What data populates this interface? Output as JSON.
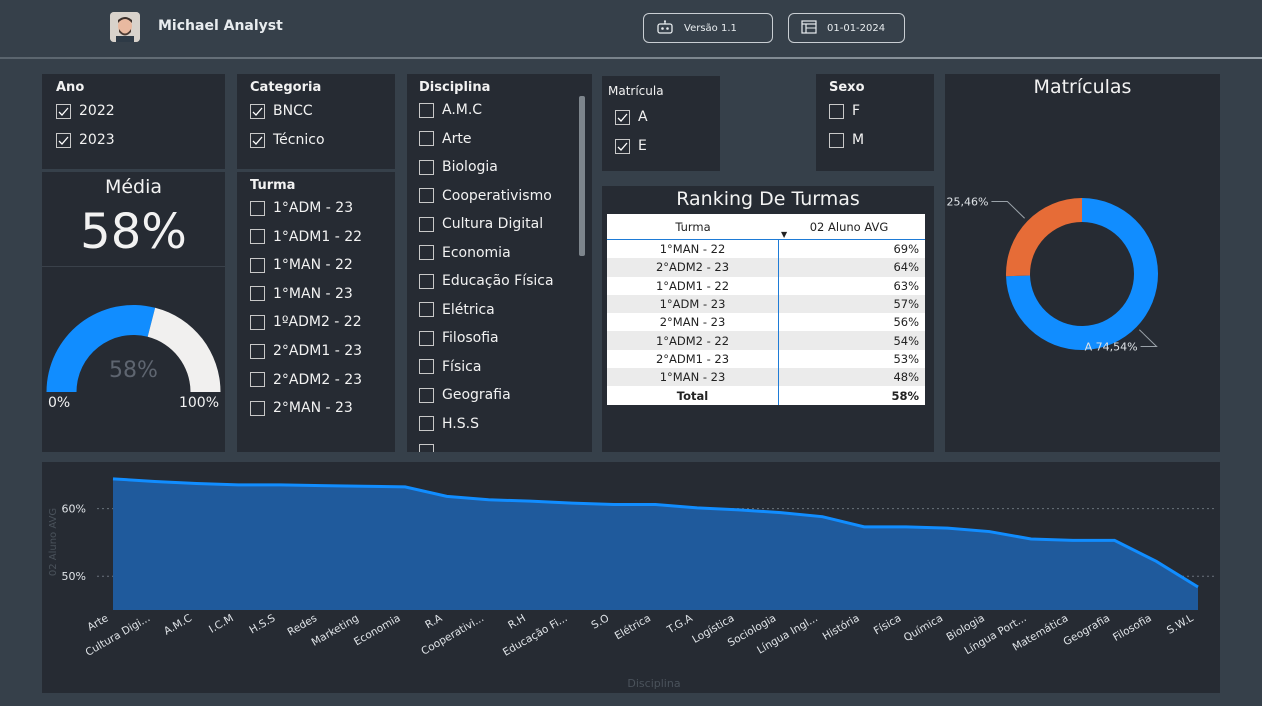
{
  "header": {
    "user_name": "Michael Analyst",
    "version_label": "Versão 1.1",
    "date_label": "01-01-2024"
  },
  "filters": {
    "ano": {
      "title": "Ano",
      "items": [
        {
          "label": "2022",
          "checked": true
        },
        {
          "label": "2023",
          "checked": true
        }
      ]
    },
    "categoria": {
      "title": "Categoria",
      "items": [
        {
          "label": "BNCC",
          "checked": true
        },
        {
          "label": "Técnico",
          "checked": true
        }
      ]
    },
    "turma": {
      "title": "Turma",
      "items": [
        {
          "label": "1°ADM - 23",
          "checked": false
        },
        {
          "label": "1°ADM1 - 22",
          "checked": false
        },
        {
          "label": "1°MAN - 22",
          "checked": false
        },
        {
          "label": "1°MAN - 23",
          "checked": false
        },
        {
          "label": "1ºADM2 - 22",
          "checked": false
        },
        {
          "label": "2°ADM1 - 23",
          "checked": false
        },
        {
          "label": "2°ADM2 - 23",
          "checked": false
        },
        {
          "label": "2°MAN - 23",
          "checked": false
        }
      ]
    },
    "disciplina": {
      "title": "Disciplina",
      "items": [
        {
          "label": "A.M.C",
          "checked": false
        },
        {
          "label": "Arte",
          "checked": false
        },
        {
          "label": "Biologia",
          "checked": false
        },
        {
          "label": "Cooperativismo",
          "checked": false
        },
        {
          "label": "Cultura Digital",
          "checked": false
        },
        {
          "label": "Economia",
          "checked": false
        },
        {
          "label": "Educação Física",
          "checked": false
        },
        {
          "label": "Elétrica",
          "checked": false
        },
        {
          "label": "Filosofia",
          "checked": false
        },
        {
          "label": "Física",
          "checked": false
        },
        {
          "label": "Geografia",
          "checked": false
        },
        {
          "label": "H.S.S",
          "checked": false
        }
      ]
    },
    "matricula": {
      "title": "Matrícula",
      "items": [
        {
          "label": "A",
          "checked": true
        },
        {
          "label": "E",
          "checked": true
        }
      ]
    },
    "sexo": {
      "title": "Sexo",
      "items": [
        {
          "label": "F",
          "checked": false
        },
        {
          "label": "M",
          "checked": false
        }
      ]
    }
  },
  "media_card": {
    "title": "Média",
    "value": "58%",
    "gauge_value_label": "58%",
    "gauge_min_label": "0%",
    "gauge_max_label": "100%",
    "gauge_fraction": 0.58,
    "gauge_color": "#118dff",
    "gauge_rest_color": "#f1f0ef"
  },
  "ranking": {
    "title": "Ranking De Turmas",
    "col1": "Turma",
    "col2": "02 Aluno AVG",
    "rows": [
      {
        "turma": "1°MAN - 22",
        "avg": "69%"
      },
      {
        "turma": "2°ADM2 - 23",
        "avg": "64%"
      },
      {
        "turma": "1°ADM1 - 22",
        "avg": "63%"
      },
      {
        "turma": "1°ADM - 23",
        "avg": "57%"
      },
      {
        "turma": "2°MAN - 23",
        "avg": "56%"
      },
      {
        "turma": "1°ADM2 - 22",
        "avg": "54%"
      },
      {
        "turma": "2°ADM1 - 23",
        "avg": "53%"
      },
      {
        "turma": "1°MAN - 23",
        "avg": "48%"
      }
    ],
    "total_label": "Total",
    "total_value": "58%"
  },
  "chart_data": [
    {
      "type": "pie",
      "title": "Matrículas",
      "slices": [
        {
          "label": "A",
          "value": 74.54,
          "value_label": "A 74,54%",
          "color": "#118dff"
        },
        {
          "label": "E",
          "value": 25.46,
          "value_label": "E 25,46%",
          "color": "#e66c37"
        }
      ]
    },
    {
      "type": "area",
      "title": "",
      "xlabel": "Disciplina",
      "ylabel": "02 Aluno AVG",
      "ylim": [
        45,
        66
      ],
      "yticks": [
        {
          "value": 50,
          "label": "50%"
        },
        {
          "value": 60,
          "label": "60%"
        }
      ],
      "categories": [
        "Arte",
        "Cultura Digi...",
        "A.M.C",
        "I.C.M",
        "H.S.S",
        "Redes",
        "Marketing",
        "Economia",
        "R.A",
        "Cooperativi...",
        "R.H",
        "Educação Fi...",
        "S.O",
        "Elétrica",
        "T.G.A",
        "Logística",
        "Sociologia",
        "Língua Ingl...",
        "História",
        "Física",
        "Química",
        "Biologia",
        "Língua Port...",
        "Matemática",
        "Geografia",
        "Filosofia",
        "S.W.L"
      ],
      "values": [
        64.4,
        64.0,
        63.7,
        63.5,
        63.5,
        63.4,
        63.3,
        63.2,
        61.8,
        61.3,
        61.1,
        60.8,
        60.6,
        60.6,
        60.1,
        59.8,
        59.4,
        58.8,
        57.3,
        57.3,
        57.1,
        56.6,
        55.5,
        55.3,
        55.3,
        52.2,
        48.4
      ],
      "line_color": "#118dff",
      "fill_color": "#1f5a9c",
      "grid": true
    }
  ]
}
